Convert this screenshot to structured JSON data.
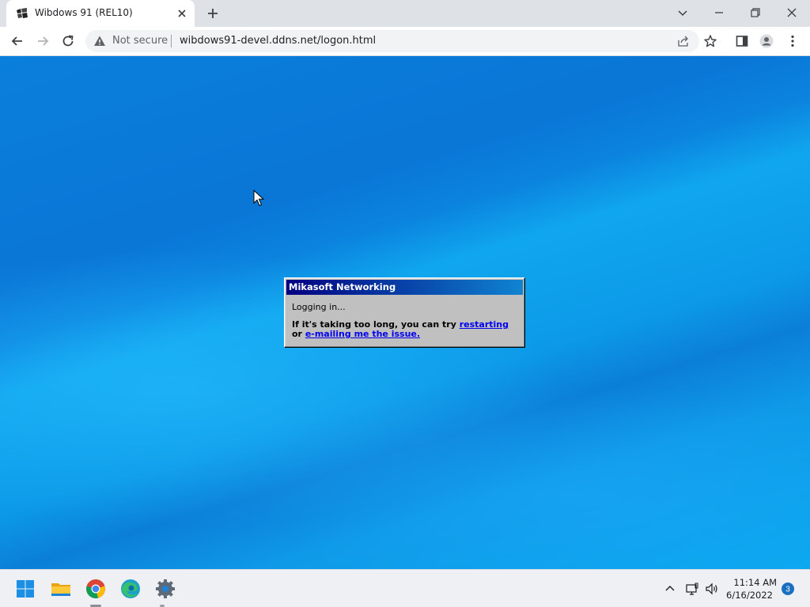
{
  "browser": {
    "tab": {
      "title": "Wibdows 91 (REL10)",
      "favicon": "wibdows-logo-icon",
      "close_icon": "close-icon"
    },
    "new_tab_icon": "plus-icon",
    "window_controls": [
      "chevron-down-icon",
      "minimize-icon",
      "restore-icon",
      "close-icon"
    ],
    "nav": [
      "back-arrow-icon",
      "forward-arrow-icon",
      "reload-icon"
    ],
    "address": {
      "security_icon": "warning-triangle-icon",
      "security_text": "Not secure",
      "url": "wibdows91-devel.ddns.net/logon.html"
    },
    "toolbar_icons": [
      "share-icon",
      "star-icon",
      "side-panel-icon",
      "profile-icon",
      "kebab-menu-icon"
    ]
  },
  "dialog": {
    "title": "Mikasoft Networking",
    "status": "Logging in...",
    "message_prefix": "If it's taking too long, you can try ",
    "restart_link": "restarting",
    "message_middle": " or ",
    "email_link": "e-mailing me the issue."
  },
  "taskbar": {
    "apps": [
      "windows-start-icon",
      "file-explorer-icon",
      "chrome-icon",
      "edge-icon",
      "settings-icon"
    ],
    "tray": [
      "chevron-up-icon",
      "network-icon",
      "volume-icon"
    ],
    "time": "11:14 AM",
    "date": "6/16/2022",
    "notification_count": "3"
  },
  "colors": {
    "titlebar_start": "#000080",
    "titlebar_end": "#1084d0",
    "link": "#0000ee",
    "dialog_face": "#c0c0c0"
  }
}
